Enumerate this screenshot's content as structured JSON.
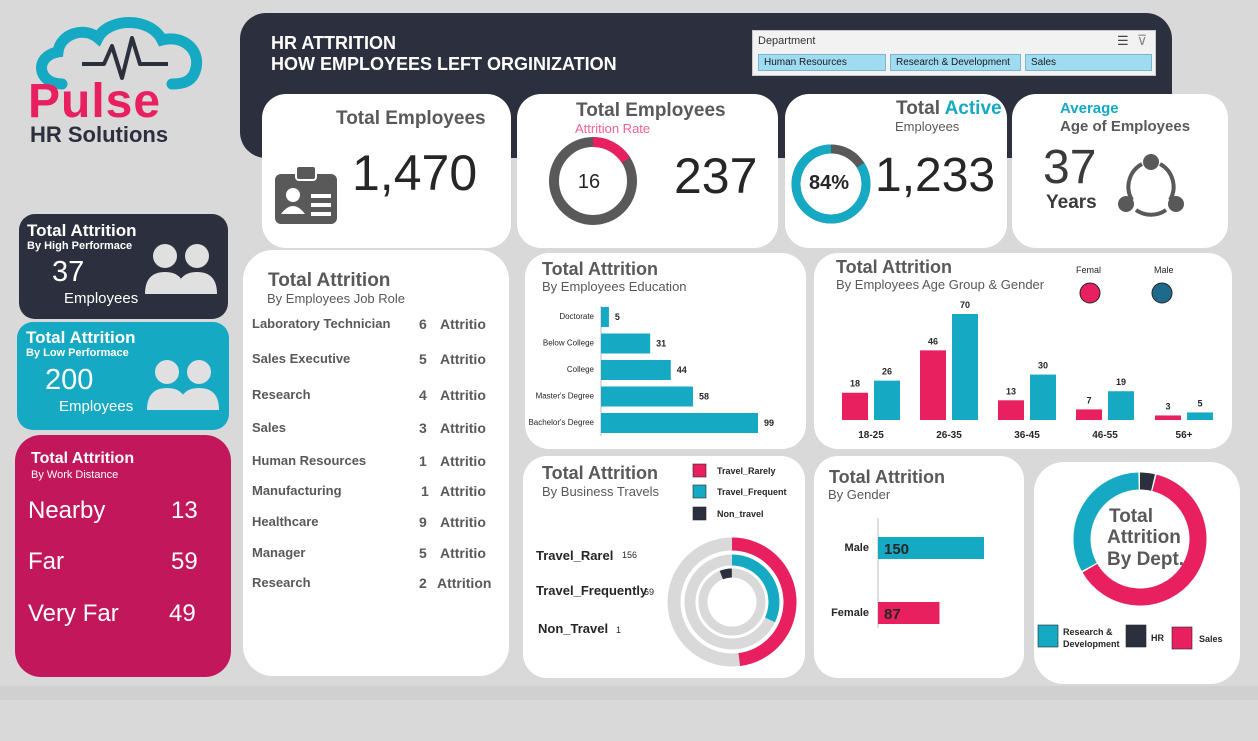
{
  "brand": {
    "name": "Pulse",
    "tagline": "HR Solutions",
    "colors": {
      "teal": "#16a9c3",
      "pink": "#e8205f",
      "dark": "#2c2f3d",
      "magenta": "#c2185b"
    }
  },
  "header": {
    "line1": "HR ATTRITION",
    "line2": "HOW EMPLOYEES LEFT ORGINIZATION"
  },
  "slicer": {
    "title": "Department",
    "items": [
      "Human Resources",
      "Research & Development",
      "Sales"
    ],
    "icons": [
      "multi-select-icon",
      "clear-filter-icon"
    ]
  },
  "kpi_total": {
    "title": "Total Employees",
    "value": "1,470",
    "icon": "id-badge-icon"
  },
  "kpi_attrition": {
    "title": "Total Employees",
    "subtitle": "Attrition Rate",
    "rate": "16",
    "rate_fraction": 0.16,
    "value": "237"
  },
  "kpi_active": {
    "title_prefix": "Total ",
    "title_accent": "Active",
    "subtitle": "Employees",
    "percent": "84%",
    "percent_fraction": 0.84,
    "value": "1,233"
  },
  "kpi_age": {
    "label_accent": "Average",
    "label": "Age of Employees",
    "value": "37",
    "unit": "Years",
    "icon": "people-network-icon"
  },
  "high_perf": {
    "title": "Total Attrition",
    "subtitle": "By High Performace",
    "value": "37",
    "unit": "Employees",
    "icon": "people-icon"
  },
  "low_perf": {
    "title": "Total Attrition",
    "subtitle": "By Low Performace",
    "value": "200",
    "unit": "Employees",
    "icon": "people-icon"
  },
  "distance": {
    "title": "Total Attrition",
    "subtitle": "By Work Distance",
    "rows": [
      {
        "label": "Nearby",
        "value": "13"
      },
      {
        "label": "Far",
        "value": "59"
      },
      {
        "label": "Very Far",
        "value": "49"
      }
    ]
  },
  "job_role": {
    "title": "Total Attrition",
    "subtitle": "By Employees Job Role",
    "rows": [
      {
        "role": "Laboratory Technician",
        "count": "6",
        "label": "Attritio"
      },
      {
        "role": "Sales Executive",
        "count": "5",
        "label": "Attritio"
      },
      {
        "role": "Research",
        "count": "4",
        "label": "Attritio"
      },
      {
        "role": "Sales",
        "count": "3",
        "label": "Attritio"
      },
      {
        "role": "Human Resources",
        "count": "1",
        "label": "Attritio"
      },
      {
        "role": "Manufacturing",
        "count": "1",
        "label": "Attritio"
      },
      {
        "role": "Healthcare",
        "count": "9",
        "label": "Attritio"
      },
      {
        "role": "Manager",
        "count": "5",
        "label": "Attritio"
      },
      {
        "role": "Research",
        "count": "2",
        "label": "Attrition"
      }
    ]
  },
  "education": {
    "title": "Total Attrition",
    "subtitle": "By Employees Education"
  },
  "age_gender": {
    "title": "Total Attrition",
    "subtitle": "By Employees Age Group & Gender"
  },
  "travel": {
    "title": "Total Attrition",
    "subtitle": "By Business Travels",
    "rows": [
      {
        "label": "Travel_Rarel",
        "value": "156"
      },
      {
        "label": "Travel_Frequently",
        "value": "69"
      },
      {
        "label": "Non_Travel",
        "value": "1"
      }
    ]
  },
  "gender": {
    "title": "Total Attrition",
    "subtitle": "By Gender"
  },
  "dept": {
    "center_text": [
      "Total",
      "Attrition",
      "By Dept."
    ]
  },
  "chart_data": [
    {
      "type": "bar",
      "orientation": "horizontal",
      "categories": [
        "Doctorate",
        "Below College",
        "College",
        "Master's Degree",
        "Bachelor's Degree"
      ],
      "values": [
        5,
        31,
        44,
        58,
        99
      ],
      "color": "#16a9c3"
    },
    {
      "type": "bar",
      "categories": [
        "18-25",
        "26-35",
        "36-45",
        "46-55",
        "56+"
      ],
      "series": [
        {
          "name": "Femal",
          "values": [
            18,
            46,
            13,
            7,
            3
          ],
          "color": "#e8205f"
        },
        {
          "name": "Male",
          "values": [
            26,
            70,
            30,
            19,
            5
          ],
          "color": "#16a9c3"
        }
      ],
      "legend": "top-right"
    },
    {
      "type": "pie",
      "subtype": "multi-ring-donut",
      "categories": [
        "Travel_Rarely",
        "Travel_Frequent",
        "Non_travel"
      ],
      "values": [
        156,
        69,
        1
      ],
      "colors": [
        "#e8205f",
        "#16a9c3",
        "#2c2f3d"
      ],
      "legend": "top"
    },
    {
      "type": "bar",
      "orientation": "horizontal",
      "categories": [
        "Male",
        "Female"
      ],
      "values": [
        150,
        87
      ],
      "colors": [
        "#16a9c3",
        "#e8205f"
      ]
    },
    {
      "type": "pie",
      "subtype": "donut",
      "categories": [
        "Research & Development",
        "HR",
        "Sales"
      ],
      "values": [
        0.33,
        0.04,
        0.63
      ],
      "colors": [
        "#16a9c3",
        "#2c2f3d",
        "#e8205f"
      ],
      "legend": "bottom"
    }
  ]
}
